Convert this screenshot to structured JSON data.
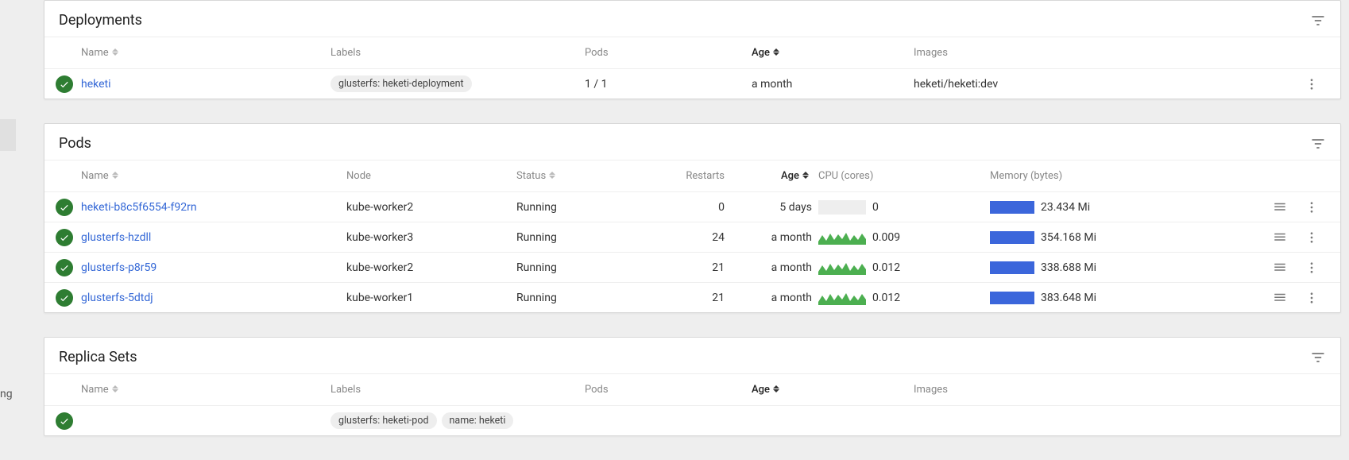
{
  "sections": {
    "deployments": {
      "title": "Deployments",
      "headers": {
        "name": "Name",
        "labels": "Labels",
        "pods": "Pods",
        "age": "Age",
        "images": "Images"
      },
      "rows": [
        {
          "name": "heketi",
          "label": "glusterfs: heketi-deployment",
          "pods": "1 / 1",
          "age": "a month",
          "images": "heketi/heketi:dev"
        }
      ]
    },
    "pods": {
      "title": "Pods",
      "headers": {
        "name": "Name",
        "node": "Node",
        "status": "Status",
        "restarts": "Restarts",
        "age": "Age",
        "cpu": "CPU (cores)",
        "mem": "Memory (bytes)"
      },
      "rows": [
        {
          "name": "heketi-b8c5f6554-f92rn",
          "node": "kube-worker2",
          "status": "Running",
          "restarts": "0",
          "age": "5 days",
          "cpu": "0",
          "mem": "23.434 Mi",
          "cpu_flat": true
        },
        {
          "name": "glusterfs-hzdll",
          "node": "kube-worker3",
          "status": "Running",
          "restarts": "24",
          "age": "a month",
          "cpu": "0.009",
          "mem": "354.168 Mi",
          "cpu_flat": false
        },
        {
          "name": "glusterfs-p8r59",
          "node": "kube-worker2",
          "status": "Running",
          "restarts": "21",
          "age": "a month",
          "cpu": "0.012",
          "mem": "338.688 Mi",
          "cpu_flat": false
        },
        {
          "name": "glusterfs-5dtdj",
          "node": "kube-worker1",
          "status": "Running",
          "restarts": "21",
          "age": "a month",
          "cpu": "0.012",
          "mem": "383.648 Mi",
          "cpu_flat": false
        }
      ]
    },
    "replicasets": {
      "title": "Replica Sets",
      "headers": {
        "name": "Name",
        "labels": "Labels",
        "pods": "Pods",
        "age": "Age",
        "images": "Images"
      },
      "rows": [
        {
          "label1": "glusterfs: heketi-pod",
          "label2": "name: heketi"
        }
      ]
    }
  },
  "truncated": "ng"
}
